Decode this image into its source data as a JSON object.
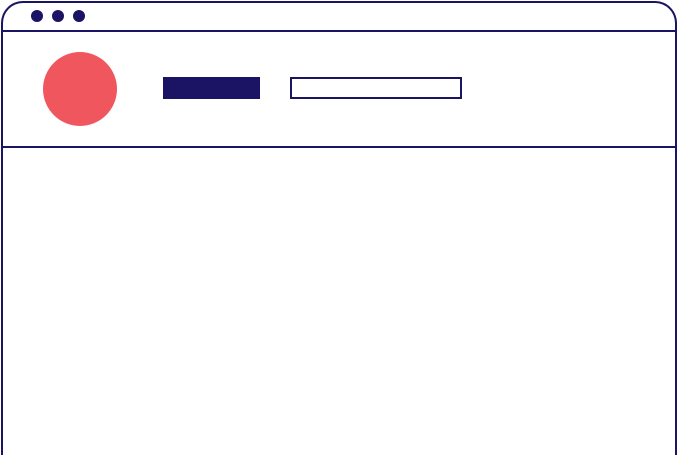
{
  "window": {
    "controls": [
      "window-dot",
      "window-dot",
      "window-dot"
    ]
  },
  "colors": {
    "outline": "#1b1464",
    "accent": "#f0565e",
    "background": "#ffffff"
  },
  "header": {
    "avatar_icon": "avatar-circle",
    "primary_bar_label": "",
    "secondary_bar_label": ""
  }
}
